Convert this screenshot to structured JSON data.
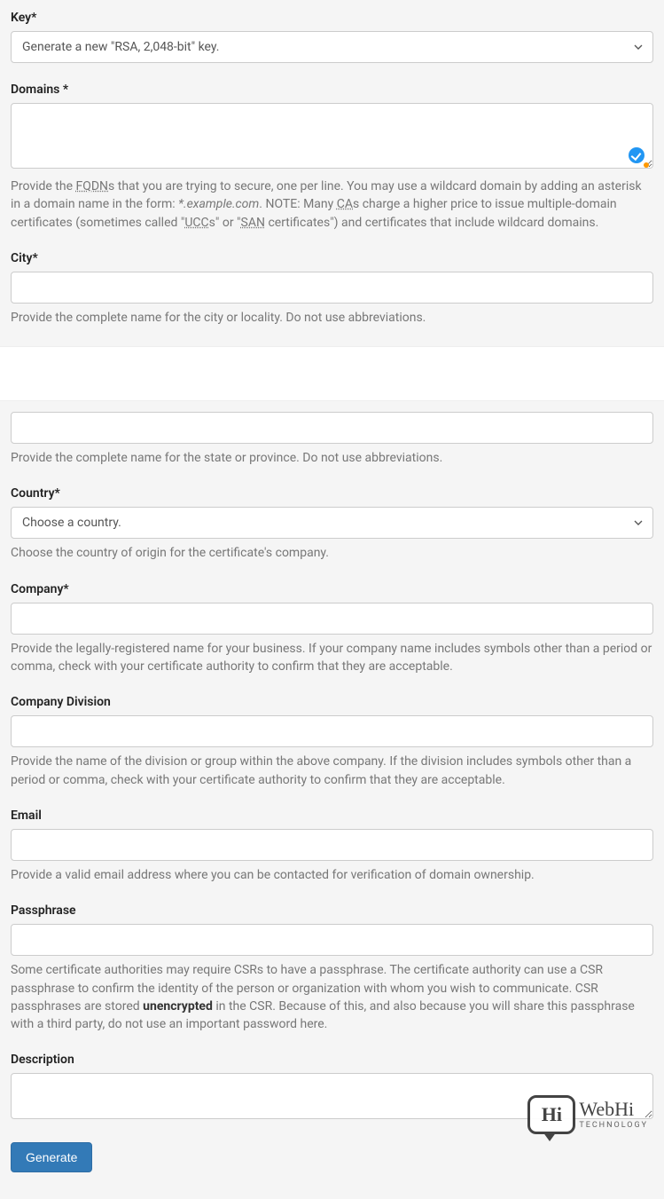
{
  "fields": {
    "key": {
      "label": "Key*",
      "selected": "Generate a new \"RSA, 2,048-bit\" key."
    },
    "domains": {
      "label": "Domains *",
      "help_prefix": "Provide the ",
      "abbr1": "FQDN",
      "help_mid1": "s that you are trying to secure, one per line. You may use a wildcard domain by adding an asterisk in a domain name in the form: ",
      "example": "*.example.com",
      "help_mid2": ". NOTE: Many ",
      "abbr2": "CA",
      "help_mid3": "s charge a higher price to issue multiple-domain certificates (sometimes called \"",
      "abbr3": "UCC",
      "help_mid4": "s\" or \"",
      "abbr4": "SAN",
      "help_mid5": " certificates\") and certificates that include wildcard domains."
    },
    "city": {
      "label": "City*",
      "help": "Provide the complete name for the city or locality. Do not use abbreviations."
    },
    "state": {
      "help": "Provide the complete name for the state or province. Do not use abbreviations."
    },
    "country": {
      "label": "Country*",
      "selected": "Choose a country.",
      "help": "Choose the country of origin for the certificate's company."
    },
    "company": {
      "label": "Company*",
      "help": "Provide the legally-registered name for your business. If your company name includes symbols other than a period or comma, check with your certificate authority to confirm that they are acceptable."
    },
    "division": {
      "label": "Company Division",
      "help": "Provide the name of the division or group within the above company. If the division includes symbols other than a period or comma, check with your certificate authority to confirm that they are acceptable."
    },
    "email": {
      "label": "Email",
      "help": "Provide a valid email address where you can be contacted for verification of domain ownership."
    },
    "passphrase": {
      "label": "Passphrase",
      "help_prefix": "Some certificate authorities may require CSRs to have a passphrase. The certificate authority can use a CSR passphrase to confirm the identity of the person or organization with whom you wish to communicate. CSR passphrases are stored ",
      "strong": "unencrypted",
      "help_suffix": " in the CSR. Because of this, and also because you will share this passphrase with a third party, do not use an important password here."
    },
    "description": {
      "label": "Description"
    }
  },
  "buttons": {
    "generate": "Generate"
  },
  "watermark": {
    "hi": "Hi",
    "line1": "WebHi",
    "line2": "TECHNOLOGY"
  }
}
